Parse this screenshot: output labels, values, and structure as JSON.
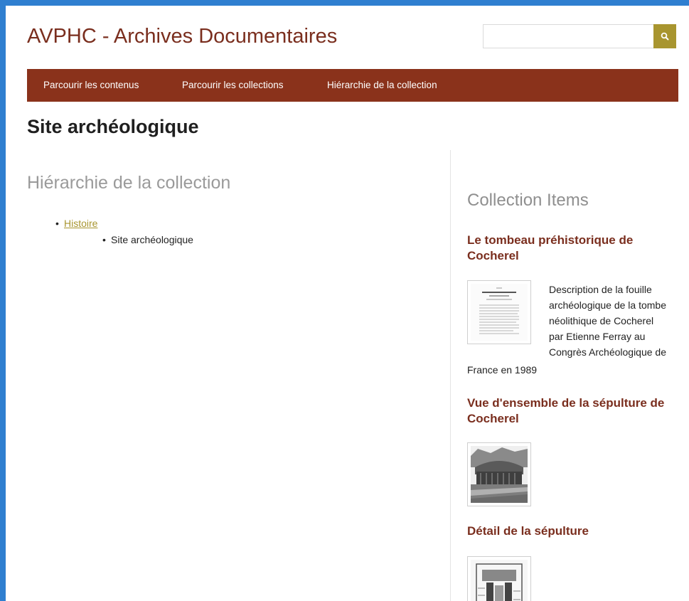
{
  "header": {
    "site_title": "AVPHC - Archives Documentaires",
    "search": {
      "value": "",
      "placeholder": ""
    },
    "search_icon": "search-icon"
  },
  "nav": {
    "items": [
      {
        "label": "Parcourir les contenus"
      },
      {
        "label": "Parcourir les collections"
      },
      {
        "label": "Hiérarchie de la collection"
      }
    ]
  },
  "page_title": "Site archéologique",
  "hierarchy": {
    "heading": "Hiérarchie de la collection",
    "parent": "Histoire",
    "child": "Site archéologique"
  },
  "collection_items": {
    "heading": "Collection Items",
    "items": [
      {
        "title": "Le tombeau préhistorique de Cocherel",
        "description_lines": [
          "Description de la fouille",
          "archéologique de la tombe",
          "néolithique de Cocherel",
          "par Etienne Ferray au",
          "Congrès Archéologique de",
          "France en 1989"
        ]
      },
      {
        "title": "Vue d'ensemble de la sépulture de Cocherel"
      },
      {
        "title": "Détail de la sépulture"
      }
    ]
  },
  "colors": {
    "brand": "#7a2e1e",
    "nav_background": "#8a321b",
    "accent": "#a8952f"
  }
}
